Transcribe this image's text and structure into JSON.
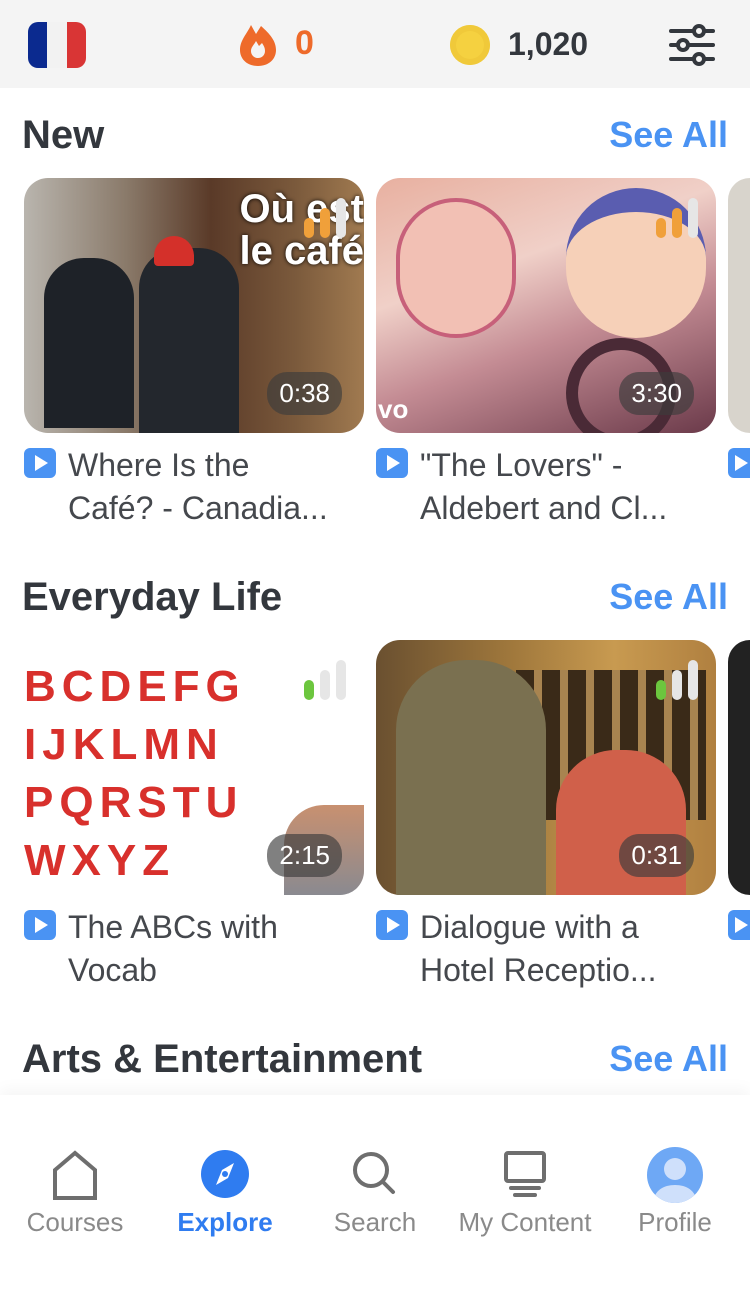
{
  "header": {
    "flag": "france-flag",
    "streak": "0",
    "coins": "1,020",
    "colors": {
      "streak": "#ee6a2a",
      "coin": "#f5d140"
    }
  },
  "sections": [
    {
      "title": "New",
      "see_all": "See All",
      "items": [
        {
          "title_line1": "Where Is the",
          "title_line2": "Café? - Canadia...",
          "duration": "0:38",
          "level": 2,
          "level_color": "#f0a03a",
          "overlay_text1": "Où est",
          "overlay_text2": "le café"
        },
        {
          "title_line1": "\"The Lovers\" -",
          "title_line2": "Aldebert and Cl...",
          "duration": "3:30",
          "level": 2,
          "level_color": "#f0a03a",
          "overlay_text1": "vo"
        }
      ]
    },
    {
      "title": "Everyday Life",
      "see_all": "See All",
      "items": [
        {
          "title_line1": "The ABCs with",
          "title_line2": "Vocab",
          "duration": "2:15",
          "level": 1,
          "level_color": "#6cc63e",
          "overlay_text1": "BCDEFG",
          "overlay_text2": "IJKLMN",
          "overlay_text3": "PQRSTU",
          "overlay_text4": "WXYZ"
        },
        {
          "title_line1": "Dialogue with a",
          "title_line2": "Hotel Receptio...",
          "duration": "0:31",
          "level": 1,
          "level_color": "#6cc63e"
        }
      ]
    },
    {
      "title": "Arts & Entertainment",
      "see_all": "See All"
    }
  ],
  "nav": {
    "active": "Explore",
    "items": [
      {
        "label": "Courses",
        "icon": "home-icon"
      },
      {
        "label": "Explore",
        "icon": "compass-icon"
      },
      {
        "label": "Search",
        "icon": "search-icon"
      },
      {
        "label": "My Content",
        "icon": "monitor-icon"
      },
      {
        "label": "Profile",
        "icon": "avatar-icon"
      }
    ]
  }
}
